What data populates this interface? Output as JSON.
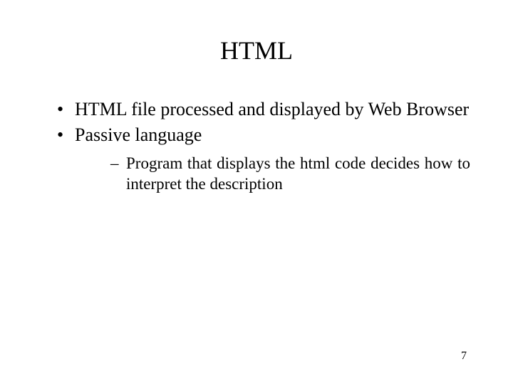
{
  "slide": {
    "title": "HTML",
    "bullets": [
      "HTML file processed and displayed by Web Browser",
      "Passive language"
    ],
    "sub_bullets": [
      "Program that displays the html code decides how to interpret the description"
    ],
    "page_number": "7"
  }
}
